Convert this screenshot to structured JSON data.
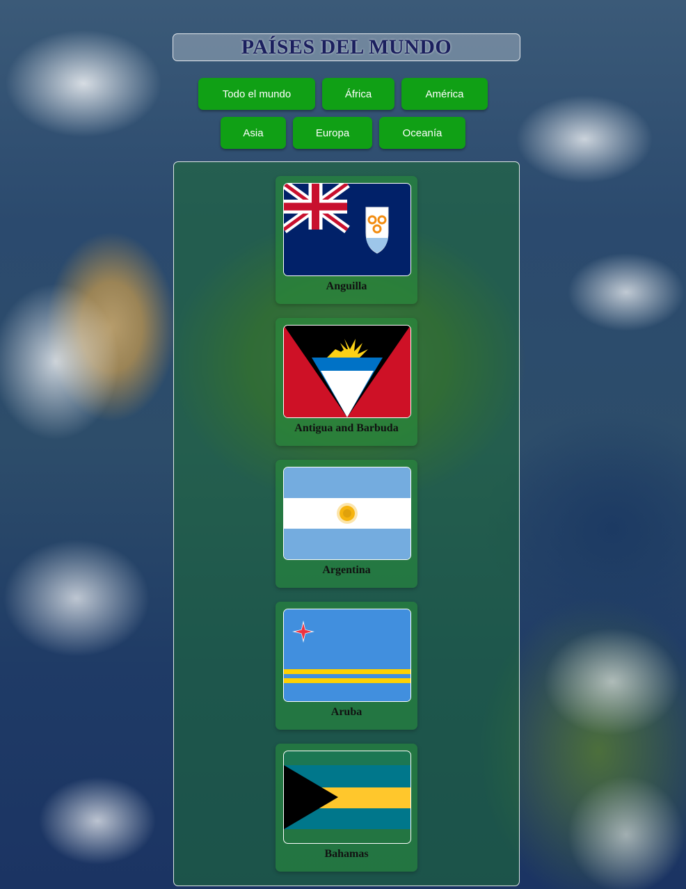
{
  "header": {
    "title": "PAÍSES DEL MUNDO"
  },
  "filters": {
    "row1": [
      "Todo el mundo",
      "África",
      "América"
    ],
    "row2": [
      "Asia",
      "Europa",
      "Oceanía"
    ]
  },
  "countries": [
    {
      "name": "Anguilla",
      "flag_icon": "anguilla-flag-icon"
    },
    {
      "name": "Antigua and Barbuda",
      "flag_icon": "antigua-and-barbuda-flag-icon"
    },
    {
      "name": "Argentina",
      "flag_icon": "argentina-flag-icon"
    },
    {
      "name": "Aruba",
      "flag_icon": "aruba-flag-icon"
    },
    {
      "name": "Bahamas",
      "flag_icon": "bahamas-flag-icon"
    }
  ],
  "colors": {
    "button_green": "#10a015",
    "title_text": "#1b1f5e",
    "panel_green": "#1e6e37"
  }
}
